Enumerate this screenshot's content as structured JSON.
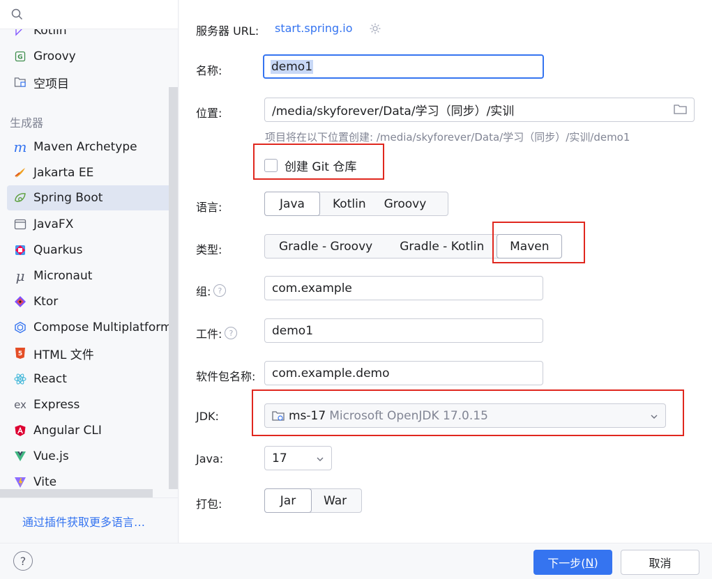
{
  "sidebar": {
    "search_placeholder": "",
    "items_top": [
      {
        "label": "Kotlin",
        "icon": "kotlin-icon"
      },
      {
        "label": "Groovy",
        "icon": "groovy-icon"
      },
      {
        "label": "空项目",
        "icon": "empty-project-icon"
      }
    ],
    "generators_heading": "生成器",
    "generators": [
      {
        "label": "Maven Archetype",
        "icon": "maven-icon"
      },
      {
        "label": "Jakarta EE",
        "icon": "jakarta-icon"
      },
      {
        "label": "Spring Boot",
        "icon": "spring-boot-icon",
        "selected": true
      },
      {
        "label": "JavaFX",
        "icon": "javafx-icon"
      },
      {
        "label": "Quarkus",
        "icon": "quarkus-icon"
      },
      {
        "label": "Micronaut",
        "icon": "micronaut-icon"
      },
      {
        "label": "Ktor",
        "icon": "ktor-icon"
      },
      {
        "label": "Compose Multiplatform",
        "icon": "compose-icon"
      },
      {
        "label": "HTML 文件",
        "icon": "html-icon"
      },
      {
        "label": "React",
        "icon": "react-icon"
      },
      {
        "label": "Express",
        "icon": "express-icon"
      },
      {
        "label": "Angular CLI",
        "icon": "angular-icon"
      },
      {
        "label": "Vue.js",
        "icon": "vue-icon"
      },
      {
        "label": "Vite",
        "icon": "vite-icon"
      }
    ],
    "more_link": "通过插件获取更多语言…"
  },
  "form": {
    "server_url_label": "服务器 URL:",
    "server_url_value": "start.spring.io",
    "name_label": "名称:",
    "name_value": "demo1",
    "location_label": "位置:",
    "location_value": "/media/skyforever/Data/学习（同步）/实训",
    "location_hint": "项目将在以下位置创建: /media/skyforever/Data/学习（同步）/实训/demo1",
    "git_checkbox_label": "创建 Git 仓库",
    "git_checked": false,
    "language_label": "语言:",
    "language_options": [
      "Java",
      "Kotlin",
      "Groovy"
    ],
    "language_selected": "Java",
    "type_label": "类型:",
    "type_options": [
      "Gradle - Groovy",
      "Gradle - Kotlin",
      "Maven"
    ],
    "type_selected": "Maven",
    "group_label": "组:",
    "group_value": "com.example",
    "artifact_label": "工件:",
    "artifact_value": "demo1",
    "package_label": "软件包名称:",
    "package_value": "com.example.demo",
    "jdk_label": "JDK:",
    "jdk_name": "ms-17",
    "jdk_detail": "Microsoft OpenJDK 17.0.15",
    "java_label": "Java:",
    "java_value": "17",
    "packaging_label": "打包:",
    "packaging_options": [
      "Jar",
      "War"
    ],
    "packaging_selected": "Jar"
  },
  "footer": {
    "help_label": "?",
    "next_label": "下一步(N)",
    "cancel_label": "取消"
  },
  "colors": {
    "accent": "#3574f0",
    "highlight_box": "#e0271e",
    "selected_item_bg": "#dfe5f2"
  }
}
